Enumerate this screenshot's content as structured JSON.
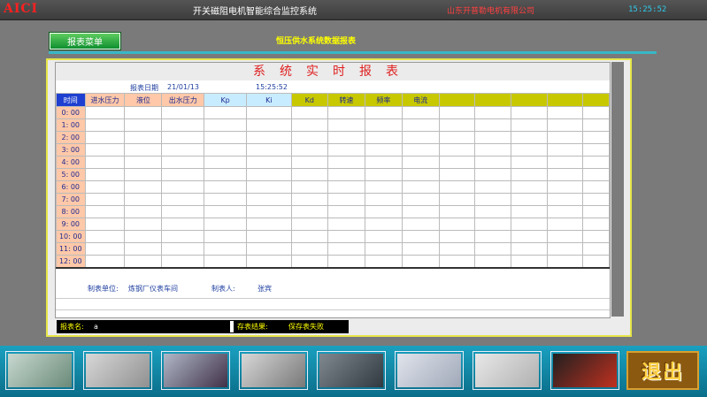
{
  "titlebar": {
    "logo": "AICI",
    "title": "开关磁阻电机智能综合监控系统",
    "company": "山东开普勒电机有限公司",
    "clock": "15:25:52"
  },
  "toolbar": {
    "report_menu_label": "报表菜单",
    "subtitle": "恒压供水系统数据报表"
  },
  "report": {
    "title": "系统实时报表",
    "date_label": "报表日期",
    "date_value": "21/01/13",
    "time_value": "15:25:52",
    "columns": [
      "时间",
      "进水压力",
      "液位",
      "出水压力",
      "Kp",
      "Ki",
      "Kd",
      "转速",
      "频率",
      "电流",
      "",
      "",
      "",
      "",
      ""
    ],
    "rows": [
      "0: 00",
      "1: 00",
      "2: 00",
      "3: 00",
      "4: 00",
      "5: 00",
      "6: 00",
      "7: 00",
      "8: 00",
      "9: 00",
      "10: 00",
      "11: 00",
      "12: 00"
    ],
    "maker_label": "制表单位:",
    "maker_value": "炼钢厂仪表车间",
    "reporter_label": "制表人:",
    "reporter_value": "张宾"
  },
  "status": {
    "name_label": "报表名:",
    "name_value": "a",
    "result_label": "存表结果:",
    "result_value": "保存表失败"
  },
  "bottom": {
    "thumbnails": [
      {
        "name": "thumb-1",
        "colors": [
          "#c8d8d0",
          "#6a8a78"
        ]
      },
      {
        "name": "thumb-2",
        "colors": [
          "#d8d8d8",
          "#909090"
        ]
      },
      {
        "name": "thumb-3",
        "colors": [
          "#b0b8c8",
          "#403048"
        ]
      },
      {
        "name": "thumb-4",
        "colors": [
          "#d8d8d8",
          "#787878"
        ]
      },
      {
        "name": "thumb-5",
        "colors": [
          "#808890",
          "#303840"
        ]
      },
      {
        "name": "thumb-6",
        "colors": [
          "#e0e4ec",
          "#a0a8b8"
        ]
      },
      {
        "name": "thumb-7",
        "colors": [
          "#e8e8e8",
          "#b0b0b0"
        ]
      },
      {
        "name": "thumb-8",
        "colors": [
          "#202020",
          "#c03020"
        ]
      }
    ],
    "exit_label": "退出"
  },
  "colors": {
    "accent": "#37b7c7",
    "frame": "#e6e64a",
    "bottom_bar": "#1aa0c0"
  }
}
